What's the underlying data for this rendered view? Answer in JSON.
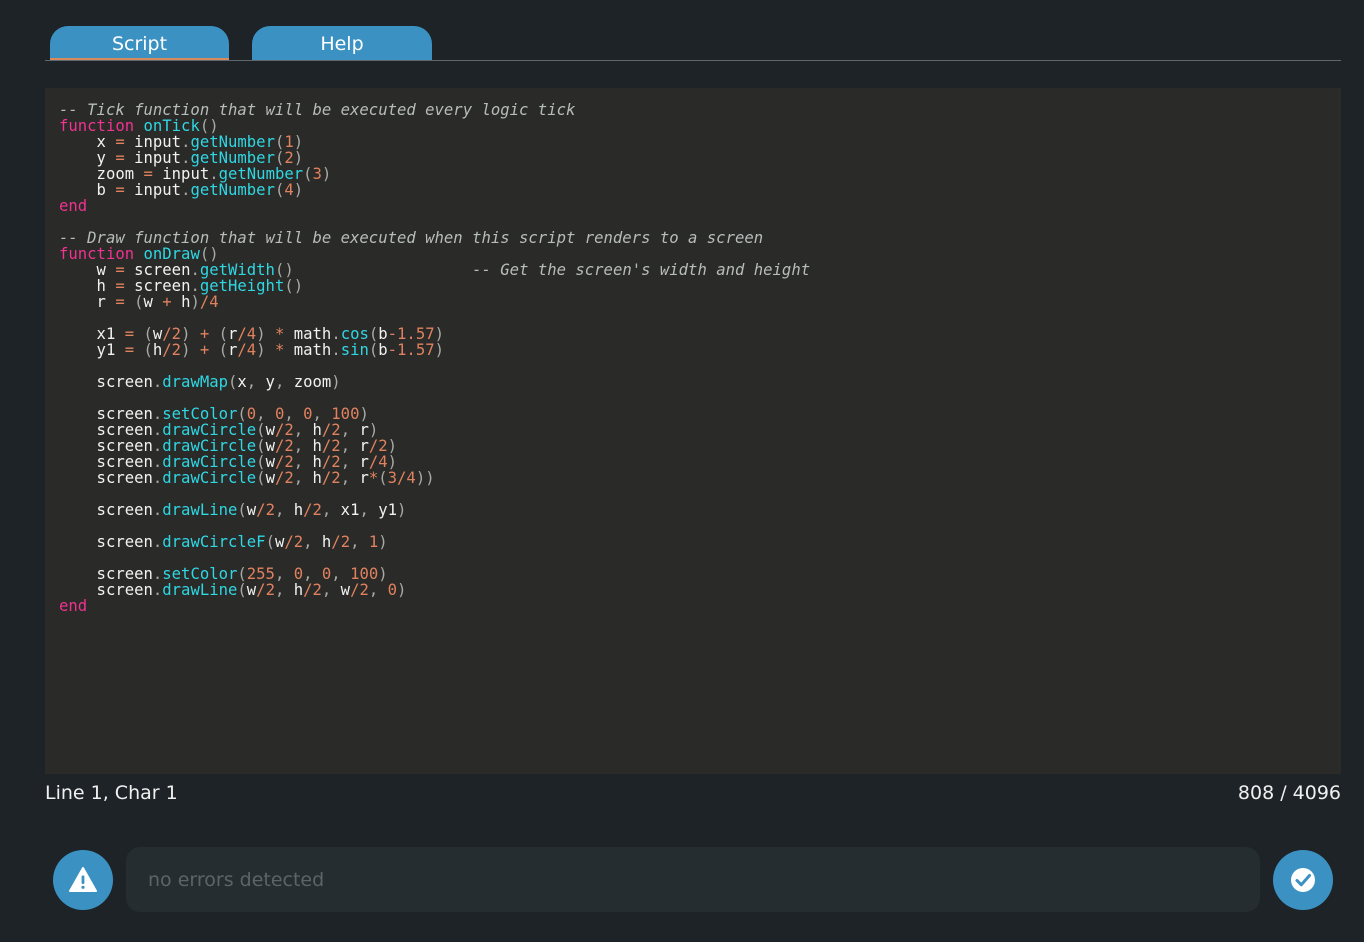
{
  "tabs": [
    {
      "label": "Script",
      "active": true
    },
    {
      "label": "Help",
      "active": false
    }
  ],
  "colors": {
    "accent": "#3b92c2",
    "active_tab_underline": "#d98a5c",
    "background": "#1d2326",
    "editor_background": "#2a2a28",
    "keyword": "#f0338f",
    "function": "#2fd7e3",
    "number": "#e0825f",
    "comment": "#b7bcbc"
  },
  "editor": {
    "lines": [
      [
        {
          "t": "cm",
          "v": "-- Tick function that will be executed every logic tick"
        }
      ],
      [
        {
          "t": "kw",
          "v": "function"
        },
        {
          "t": "id",
          "v": " "
        },
        {
          "t": "fn",
          "v": "onTick"
        },
        {
          "t": "punc",
          "v": "()"
        }
      ],
      [
        {
          "t": "id",
          "v": "    x "
        },
        {
          "t": "op",
          "v": "="
        },
        {
          "t": "id",
          "v": " input"
        },
        {
          "t": "punc",
          "v": "."
        },
        {
          "t": "fn",
          "v": "getNumber"
        },
        {
          "t": "punc",
          "v": "("
        },
        {
          "t": "num",
          "v": "1"
        },
        {
          "t": "punc",
          "v": ")"
        }
      ],
      [
        {
          "t": "id",
          "v": "    y "
        },
        {
          "t": "op",
          "v": "="
        },
        {
          "t": "id",
          "v": " input"
        },
        {
          "t": "punc",
          "v": "."
        },
        {
          "t": "fn",
          "v": "getNumber"
        },
        {
          "t": "punc",
          "v": "("
        },
        {
          "t": "num",
          "v": "2"
        },
        {
          "t": "punc",
          "v": ")"
        }
      ],
      [
        {
          "t": "id",
          "v": "    zoom "
        },
        {
          "t": "op",
          "v": "="
        },
        {
          "t": "id",
          "v": " input"
        },
        {
          "t": "punc",
          "v": "."
        },
        {
          "t": "fn",
          "v": "getNumber"
        },
        {
          "t": "punc",
          "v": "("
        },
        {
          "t": "num",
          "v": "3"
        },
        {
          "t": "punc",
          "v": ")"
        }
      ],
      [
        {
          "t": "id",
          "v": "    b "
        },
        {
          "t": "op",
          "v": "="
        },
        {
          "t": "id",
          "v": " input"
        },
        {
          "t": "punc",
          "v": "."
        },
        {
          "t": "fn",
          "v": "getNumber"
        },
        {
          "t": "punc",
          "v": "("
        },
        {
          "t": "num",
          "v": "4"
        },
        {
          "t": "punc",
          "v": ")"
        }
      ],
      [
        {
          "t": "kw",
          "v": "end"
        }
      ],
      [],
      [
        {
          "t": "cm",
          "v": "-- Draw function that will be executed when this script renders to a screen"
        }
      ],
      [
        {
          "t": "kw",
          "v": "function"
        },
        {
          "t": "id",
          "v": " "
        },
        {
          "t": "fn",
          "v": "onDraw"
        },
        {
          "t": "punc",
          "v": "()"
        }
      ],
      [
        {
          "t": "id",
          "v": "    w "
        },
        {
          "t": "op",
          "v": "="
        },
        {
          "t": "id",
          "v": " screen"
        },
        {
          "t": "punc",
          "v": "."
        },
        {
          "t": "fn",
          "v": "getWidth"
        },
        {
          "t": "punc",
          "v": "()"
        },
        {
          "t": "id",
          "v": "                   "
        },
        {
          "t": "cm",
          "v": "-- Get the screen's width and height"
        }
      ],
      [
        {
          "t": "id",
          "v": "    h "
        },
        {
          "t": "op",
          "v": "="
        },
        {
          "t": "id",
          "v": " screen"
        },
        {
          "t": "punc",
          "v": "."
        },
        {
          "t": "fn",
          "v": "getHeight"
        },
        {
          "t": "punc",
          "v": "()"
        }
      ],
      [
        {
          "t": "id",
          "v": "    r "
        },
        {
          "t": "op",
          "v": "="
        },
        {
          "t": "id",
          "v": " "
        },
        {
          "t": "punc",
          "v": "("
        },
        {
          "t": "id",
          "v": "w "
        },
        {
          "t": "op",
          "v": "+"
        },
        {
          "t": "id",
          "v": " h"
        },
        {
          "t": "punc",
          "v": ")"
        },
        {
          "t": "op",
          "v": "/"
        },
        {
          "t": "num",
          "v": "4"
        }
      ],
      [],
      [
        {
          "t": "id",
          "v": "    x1 "
        },
        {
          "t": "op",
          "v": "="
        },
        {
          "t": "id",
          "v": " "
        },
        {
          "t": "punc",
          "v": "("
        },
        {
          "t": "id",
          "v": "w"
        },
        {
          "t": "op",
          "v": "/"
        },
        {
          "t": "num",
          "v": "2"
        },
        {
          "t": "punc",
          "v": ")"
        },
        {
          "t": "id",
          "v": " "
        },
        {
          "t": "op",
          "v": "+"
        },
        {
          "t": "id",
          "v": " "
        },
        {
          "t": "punc",
          "v": "("
        },
        {
          "t": "id",
          "v": "r"
        },
        {
          "t": "op",
          "v": "/"
        },
        {
          "t": "num",
          "v": "4"
        },
        {
          "t": "punc",
          "v": ")"
        },
        {
          "t": "id",
          "v": " "
        },
        {
          "t": "op",
          "v": "*"
        },
        {
          "t": "id",
          "v": " math"
        },
        {
          "t": "punc",
          "v": "."
        },
        {
          "t": "fn",
          "v": "cos"
        },
        {
          "t": "punc",
          "v": "("
        },
        {
          "t": "id",
          "v": "b"
        },
        {
          "t": "op",
          "v": "-"
        },
        {
          "t": "num",
          "v": "1.57"
        },
        {
          "t": "punc",
          "v": ")"
        }
      ],
      [
        {
          "t": "id",
          "v": "    y1 "
        },
        {
          "t": "op",
          "v": "="
        },
        {
          "t": "id",
          "v": " "
        },
        {
          "t": "punc",
          "v": "("
        },
        {
          "t": "id",
          "v": "h"
        },
        {
          "t": "op",
          "v": "/"
        },
        {
          "t": "num",
          "v": "2"
        },
        {
          "t": "punc",
          "v": ")"
        },
        {
          "t": "id",
          "v": " "
        },
        {
          "t": "op",
          "v": "+"
        },
        {
          "t": "id",
          "v": " "
        },
        {
          "t": "punc",
          "v": "("
        },
        {
          "t": "id",
          "v": "r"
        },
        {
          "t": "op",
          "v": "/"
        },
        {
          "t": "num",
          "v": "4"
        },
        {
          "t": "punc",
          "v": ")"
        },
        {
          "t": "id",
          "v": " "
        },
        {
          "t": "op",
          "v": "*"
        },
        {
          "t": "id",
          "v": " math"
        },
        {
          "t": "punc",
          "v": "."
        },
        {
          "t": "fn",
          "v": "sin"
        },
        {
          "t": "punc",
          "v": "("
        },
        {
          "t": "id",
          "v": "b"
        },
        {
          "t": "op",
          "v": "-"
        },
        {
          "t": "num",
          "v": "1.57"
        },
        {
          "t": "punc",
          "v": ")"
        }
      ],
      [],
      [
        {
          "t": "id",
          "v": "    screen"
        },
        {
          "t": "punc",
          "v": "."
        },
        {
          "t": "fn",
          "v": "drawMap"
        },
        {
          "t": "punc",
          "v": "("
        },
        {
          "t": "id",
          "v": "x"
        },
        {
          "t": "punc",
          "v": ","
        },
        {
          "t": "id",
          "v": " y"
        },
        {
          "t": "punc",
          "v": ","
        },
        {
          "t": "id",
          "v": " zoom"
        },
        {
          "t": "punc",
          "v": ")"
        }
      ],
      [],
      [
        {
          "t": "id",
          "v": "    screen"
        },
        {
          "t": "punc",
          "v": "."
        },
        {
          "t": "fn",
          "v": "setColor"
        },
        {
          "t": "punc",
          "v": "("
        },
        {
          "t": "num",
          "v": "0"
        },
        {
          "t": "punc",
          "v": ", "
        },
        {
          "t": "num",
          "v": "0"
        },
        {
          "t": "punc",
          "v": ", "
        },
        {
          "t": "num",
          "v": "0"
        },
        {
          "t": "punc",
          "v": ", "
        },
        {
          "t": "num",
          "v": "100"
        },
        {
          "t": "punc",
          "v": ")"
        }
      ],
      [
        {
          "t": "id",
          "v": "    screen"
        },
        {
          "t": "punc",
          "v": "."
        },
        {
          "t": "fn",
          "v": "drawCircle"
        },
        {
          "t": "punc",
          "v": "("
        },
        {
          "t": "id",
          "v": "w"
        },
        {
          "t": "op",
          "v": "/"
        },
        {
          "t": "num",
          "v": "2"
        },
        {
          "t": "punc",
          "v": ","
        },
        {
          "t": "id",
          "v": " h"
        },
        {
          "t": "op",
          "v": "/"
        },
        {
          "t": "num",
          "v": "2"
        },
        {
          "t": "punc",
          "v": ","
        },
        {
          "t": "id",
          "v": " r"
        },
        {
          "t": "punc",
          "v": ")"
        }
      ],
      [
        {
          "t": "id",
          "v": "    screen"
        },
        {
          "t": "punc",
          "v": "."
        },
        {
          "t": "fn",
          "v": "drawCircle"
        },
        {
          "t": "punc",
          "v": "("
        },
        {
          "t": "id",
          "v": "w"
        },
        {
          "t": "op",
          "v": "/"
        },
        {
          "t": "num",
          "v": "2"
        },
        {
          "t": "punc",
          "v": ","
        },
        {
          "t": "id",
          "v": " h"
        },
        {
          "t": "op",
          "v": "/"
        },
        {
          "t": "num",
          "v": "2"
        },
        {
          "t": "punc",
          "v": ","
        },
        {
          "t": "id",
          "v": " r"
        },
        {
          "t": "op",
          "v": "/"
        },
        {
          "t": "num",
          "v": "2"
        },
        {
          "t": "punc",
          "v": ")"
        }
      ],
      [
        {
          "t": "id",
          "v": "    screen"
        },
        {
          "t": "punc",
          "v": "."
        },
        {
          "t": "fn",
          "v": "drawCircle"
        },
        {
          "t": "punc",
          "v": "("
        },
        {
          "t": "id",
          "v": "w"
        },
        {
          "t": "op",
          "v": "/"
        },
        {
          "t": "num",
          "v": "2"
        },
        {
          "t": "punc",
          "v": ","
        },
        {
          "t": "id",
          "v": " h"
        },
        {
          "t": "op",
          "v": "/"
        },
        {
          "t": "num",
          "v": "2"
        },
        {
          "t": "punc",
          "v": ","
        },
        {
          "t": "id",
          "v": " r"
        },
        {
          "t": "op",
          "v": "/"
        },
        {
          "t": "num",
          "v": "4"
        },
        {
          "t": "punc",
          "v": ")"
        }
      ],
      [
        {
          "t": "id",
          "v": "    screen"
        },
        {
          "t": "punc",
          "v": "."
        },
        {
          "t": "fn",
          "v": "drawCircle"
        },
        {
          "t": "punc",
          "v": "("
        },
        {
          "t": "id",
          "v": "w"
        },
        {
          "t": "op",
          "v": "/"
        },
        {
          "t": "num",
          "v": "2"
        },
        {
          "t": "punc",
          "v": ","
        },
        {
          "t": "id",
          "v": " h"
        },
        {
          "t": "op",
          "v": "/"
        },
        {
          "t": "num",
          "v": "2"
        },
        {
          "t": "punc",
          "v": ","
        },
        {
          "t": "id",
          "v": " r"
        },
        {
          "t": "op",
          "v": "*"
        },
        {
          "t": "punc",
          "v": "("
        },
        {
          "t": "num",
          "v": "3/4"
        },
        {
          "t": "punc",
          "v": "))"
        }
      ],
      [],
      [
        {
          "t": "id",
          "v": "    screen"
        },
        {
          "t": "punc",
          "v": "."
        },
        {
          "t": "fn",
          "v": "drawLine"
        },
        {
          "t": "punc",
          "v": "("
        },
        {
          "t": "id",
          "v": "w"
        },
        {
          "t": "op",
          "v": "/"
        },
        {
          "t": "num",
          "v": "2"
        },
        {
          "t": "punc",
          "v": ","
        },
        {
          "t": "id",
          "v": " h"
        },
        {
          "t": "op",
          "v": "/"
        },
        {
          "t": "num",
          "v": "2"
        },
        {
          "t": "punc",
          "v": ","
        },
        {
          "t": "id",
          "v": " x1"
        },
        {
          "t": "punc",
          "v": ","
        },
        {
          "t": "id",
          "v": " y1"
        },
        {
          "t": "punc",
          "v": ")"
        }
      ],
      [],
      [
        {
          "t": "id",
          "v": "    screen"
        },
        {
          "t": "punc",
          "v": "."
        },
        {
          "t": "fn",
          "v": "drawCircleF"
        },
        {
          "t": "punc",
          "v": "("
        },
        {
          "t": "id",
          "v": "w"
        },
        {
          "t": "op",
          "v": "/"
        },
        {
          "t": "num",
          "v": "2"
        },
        {
          "t": "punc",
          "v": ","
        },
        {
          "t": "id",
          "v": " h"
        },
        {
          "t": "op",
          "v": "/"
        },
        {
          "t": "num",
          "v": "2"
        },
        {
          "t": "punc",
          "v": ", "
        },
        {
          "t": "num",
          "v": "1"
        },
        {
          "t": "punc",
          "v": ")"
        }
      ],
      [],
      [
        {
          "t": "id",
          "v": "    screen"
        },
        {
          "t": "punc",
          "v": "."
        },
        {
          "t": "fn",
          "v": "setColor"
        },
        {
          "t": "punc",
          "v": "("
        },
        {
          "t": "num",
          "v": "255"
        },
        {
          "t": "punc",
          "v": ", "
        },
        {
          "t": "num",
          "v": "0"
        },
        {
          "t": "punc",
          "v": ", "
        },
        {
          "t": "num",
          "v": "0"
        },
        {
          "t": "punc",
          "v": ", "
        },
        {
          "t": "num",
          "v": "100"
        },
        {
          "t": "punc",
          "v": ")"
        }
      ],
      [
        {
          "t": "id",
          "v": "    screen"
        },
        {
          "t": "punc",
          "v": "."
        },
        {
          "t": "fn",
          "v": "drawLine"
        },
        {
          "t": "punc",
          "v": "("
        },
        {
          "t": "id",
          "v": "w"
        },
        {
          "t": "op",
          "v": "/"
        },
        {
          "t": "num",
          "v": "2"
        },
        {
          "t": "punc",
          "v": ","
        },
        {
          "t": "id",
          "v": " h"
        },
        {
          "t": "op",
          "v": "/"
        },
        {
          "t": "num",
          "v": "2"
        },
        {
          "t": "punc",
          "v": ","
        },
        {
          "t": "id",
          "v": " w"
        },
        {
          "t": "op",
          "v": "/"
        },
        {
          "t": "num",
          "v": "2"
        },
        {
          "t": "punc",
          "v": ", "
        },
        {
          "t": "num",
          "v": "0"
        },
        {
          "t": "punc",
          "v": ")"
        }
      ],
      [
        {
          "t": "kw",
          "v": "end"
        }
      ]
    ]
  },
  "status": {
    "cursor_position": "Line 1, Char 1",
    "char_count": "808 / 4096"
  },
  "bottom_bar": {
    "errors_text": "no errors detected",
    "warning_icon": "warning-icon",
    "confirm_icon": "check-icon"
  }
}
